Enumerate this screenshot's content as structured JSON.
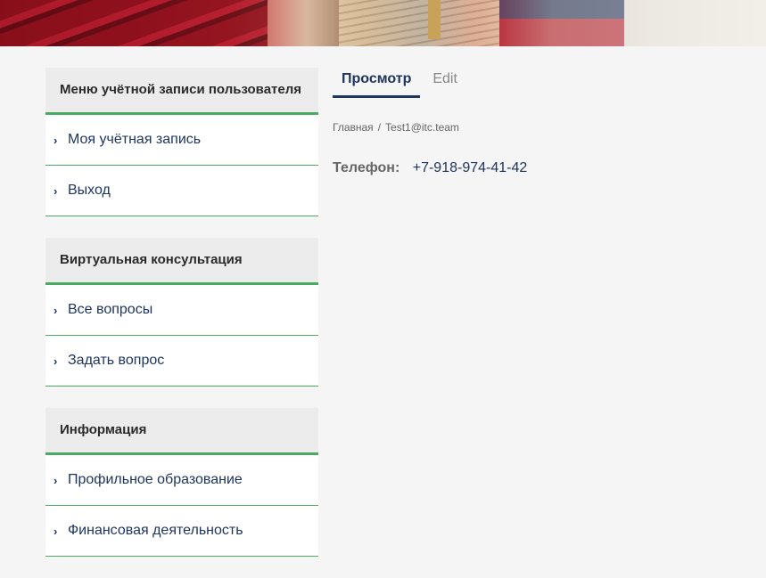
{
  "sidebar": {
    "blocks": [
      {
        "title": "Меню учётной записи пользователя",
        "items": [
          "Моя учётная запись",
          "Выход"
        ]
      },
      {
        "title": "Виртуальная консультация",
        "items": [
          "Все вопросы",
          "Задать вопрос"
        ]
      },
      {
        "title": "Информация",
        "items": [
          "Профильное образование",
          "Финансовая деятельность"
        ]
      }
    ]
  },
  "tabs": {
    "view": "Просмотр",
    "edit": "Edit"
  },
  "breadcrumb": {
    "home": "Главная",
    "separator": "/",
    "current": "Test1@itc.team"
  },
  "profile": {
    "phone_label": "Телефон:",
    "phone_value": "+7-918-974-41-42"
  },
  "colors": {
    "accent_green": "#4aaa62",
    "navy": "#1e3560"
  }
}
